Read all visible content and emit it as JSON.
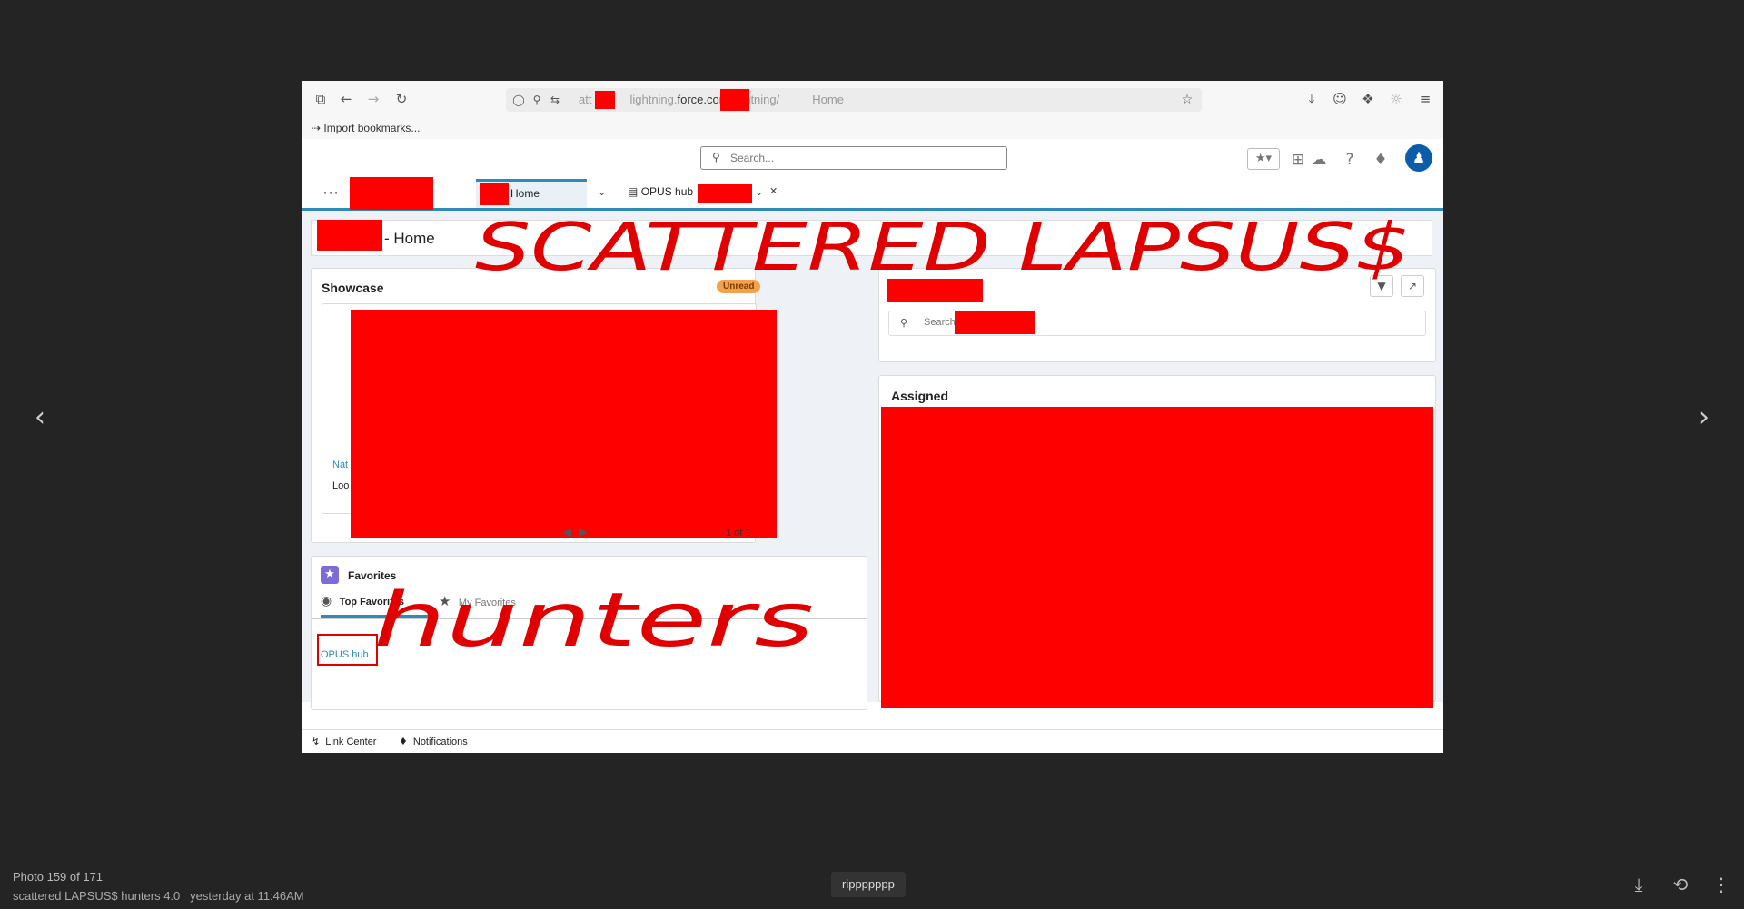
{
  "viewer": {
    "prev_icon": "chevron-left-icon",
    "next_icon": "chevron-right-icon",
    "photo_counter": "Photo 159 of 171",
    "album_name": "scattered LAPSUS$ hunters 4.0",
    "timestamp": "yesterday at 11:46AM",
    "caption": "rippppppp",
    "actions": [
      "download-icon",
      "rotate-icon",
      "more-vertical-icon"
    ]
  },
  "browser": {
    "url_prefix": "att",
    "url_domain": "lightning.",
    "url_main": "force.com",
    "url_path": "/lightning/",
    "url_end": "Home",
    "bookmark_label": "Import bookmarks..."
  },
  "salesforce": {
    "search_placeholder": "Search...",
    "tabs": {
      "home_label": "Home",
      "opus_label": "OPUS hub"
    },
    "page_title_suffix": "- Home",
    "showcase": {
      "title": "Showcase",
      "badge": "Unread",
      "partial_link": "Nat",
      "partial_text": "Loo",
      "pager": "1 of 1"
    },
    "right_card": {
      "search_placeholder": "Search"
    },
    "assigned": {
      "title": "Assigned"
    },
    "favorites": {
      "title": "Favorites",
      "tab_top": "Top Favorites",
      "tab_my": "My Favorites",
      "link": "OPUS hub"
    },
    "utility_bar": {
      "link_center": "Link Center",
      "notifications": "Notifications"
    }
  },
  "handwriting": {
    "line1": "SCATTERED LAPSUS$",
    "line2": "hunters"
  },
  "colors": {
    "redaction": "#ff0000",
    "sf_accent": "#2f8bb5",
    "avatar": "#0b5cab",
    "viewer_bg": "#242424"
  }
}
